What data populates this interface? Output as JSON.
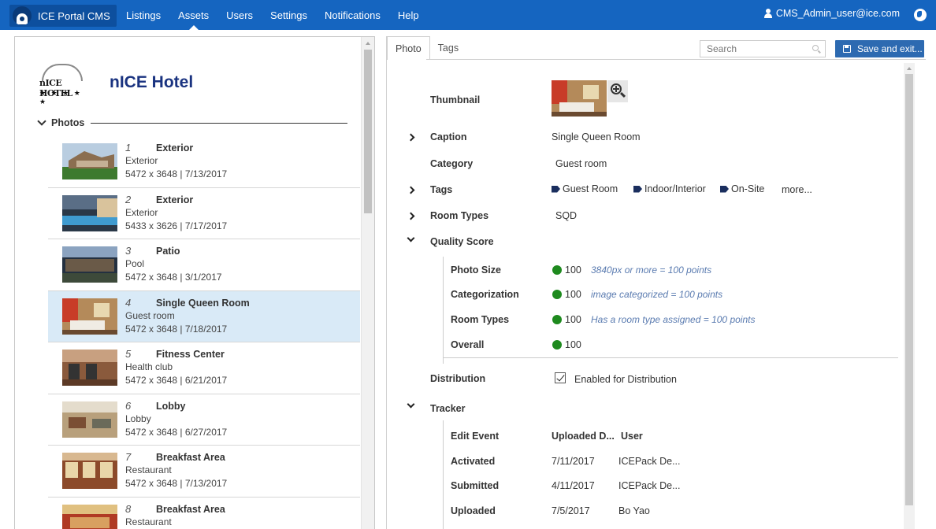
{
  "app": {
    "brand": "ICE Portal CMS"
  },
  "nav": [
    {
      "label": "Listings",
      "active": false
    },
    {
      "label": "Assets",
      "active": true
    },
    {
      "label": "Users",
      "active": false
    },
    {
      "label": "Settings",
      "active": false
    },
    {
      "label": "Notifications",
      "active": false
    },
    {
      "label": "Help",
      "active": false
    }
  ],
  "user": {
    "email": "CMS_Admin_user@ice.com"
  },
  "hotel": {
    "name": "nICE Hotel",
    "logo_text": "nICE HOTEL",
    "logo_stars": "★ ★ ★ ★ ★"
  },
  "photos_section": {
    "label": "Photos"
  },
  "photos": [
    {
      "num": "1",
      "title": "Exterior",
      "category": "Exterior",
      "meta": "5472 x 3648 | 7/13/2017",
      "selected": false
    },
    {
      "num": "2",
      "title": "Exterior",
      "category": "Exterior",
      "meta": "5433 x 3626 | 7/17/2017",
      "selected": false
    },
    {
      "num": "3",
      "title": "Patio",
      "category": "Pool",
      "meta": "5472 x 3648 | 3/1/2017",
      "selected": false
    },
    {
      "num": "4",
      "title": "Single Queen Room",
      "category": "Guest room",
      "meta": "5472 x 3648 | 7/18/2017",
      "selected": true
    },
    {
      "num": "5",
      "title": "Fitness Center",
      "category": "Health club",
      "meta": "5472 x 3648 | 6/21/2017",
      "selected": false
    },
    {
      "num": "6",
      "title": "Lobby",
      "category": "Lobby",
      "meta": "5472 x 3648 | 6/27/2017",
      "selected": false
    },
    {
      "num": "7",
      "title": "Breakfast Area",
      "category": "Restaurant",
      "meta": "5472 x 3648 | 7/13/2017",
      "selected": false
    },
    {
      "num": "8",
      "title": "Breakfast Area",
      "category": "Restaurant",
      "meta": "",
      "selected": false
    }
  ],
  "tabs": [
    {
      "label": "Photo",
      "active": true
    },
    {
      "label": "Tags",
      "active": false
    }
  ],
  "search": {
    "placeholder": "Search"
  },
  "save_button": {
    "label": "Save and exit..."
  },
  "details": {
    "thumbnail_label": "Thumbnail",
    "caption_label": "Caption",
    "caption_value": "Single Queen Room",
    "category_label": "Category",
    "category_value": "Guest room",
    "tags_label": "Tags",
    "tags": [
      "Guest Room",
      "Indoor/Interior",
      "On-Site"
    ],
    "tags_more": "more...",
    "room_types_label": "Room Types",
    "room_types_value": "SQD",
    "quality_label": "Quality Score",
    "quality_rows": [
      {
        "label": "Photo Size",
        "score": "100",
        "hint": "3840px or more = 100 points"
      },
      {
        "label": "Categorization",
        "score": "100",
        "hint": "image categorized = 100 points"
      },
      {
        "label": "Room Types",
        "score": "100",
        "hint": "Has a room type assigned = 100 points"
      }
    ],
    "overall_label": "Overall",
    "overall_score": "100",
    "distribution_label": "Distribution",
    "distribution_value": "Enabled for Distribution",
    "distribution_checked": true,
    "tracker_label": "Tracker",
    "tracker_headers": [
      "Edit Event",
      "Uploaded D...",
      "User"
    ],
    "tracker_rows": [
      {
        "event": "Activated",
        "date": "7/11/2017",
        "user": "ICEPack De..."
      },
      {
        "event": "Submitted",
        "date": "4/11/2017",
        "user": "ICEPack De..."
      },
      {
        "event": "Uploaded",
        "date": "7/5/2017",
        "user": "Bo Yao"
      }
    ]
  },
  "colors": {
    "topbar": "#1565c0",
    "selected_row": "#d9eaf7",
    "score_dot": "#1e8a1e",
    "hint": "#5a7bb0",
    "hotel_name": "#1a3380"
  }
}
